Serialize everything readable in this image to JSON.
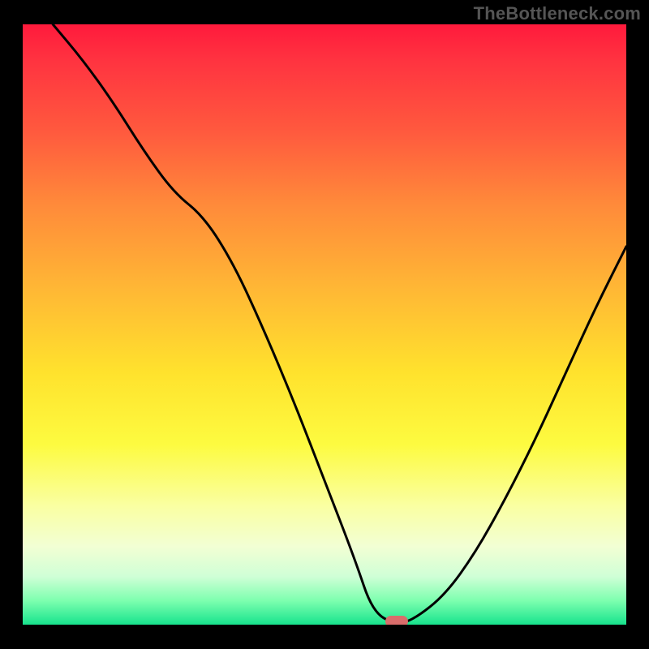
{
  "attribution": "TheBottleneck.com",
  "chart_data": {
    "type": "line",
    "title": "",
    "xlabel": "",
    "ylabel": "",
    "xlim": [
      0,
      100
    ],
    "ylim": [
      0,
      100
    ],
    "x": [
      5,
      10,
      15,
      20,
      25,
      30,
      35,
      40,
      45,
      50,
      55,
      58,
      62,
      65,
      70,
      75,
      80,
      85,
      90,
      95,
      100
    ],
    "values": [
      100,
      94,
      87,
      79,
      72,
      68,
      60,
      49,
      37,
      24,
      11,
      2,
      0,
      1,
      5,
      12,
      21,
      31,
      42,
      53,
      63
    ],
    "min_point": {
      "x": 62,
      "y": 0
    },
    "gradient_colors": {
      "top": "#ff1a3c",
      "mid": "#ffe22d",
      "bottom": "#17e38d"
    },
    "marker_color": "#d96d6b",
    "curve_color": "#000000"
  }
}
